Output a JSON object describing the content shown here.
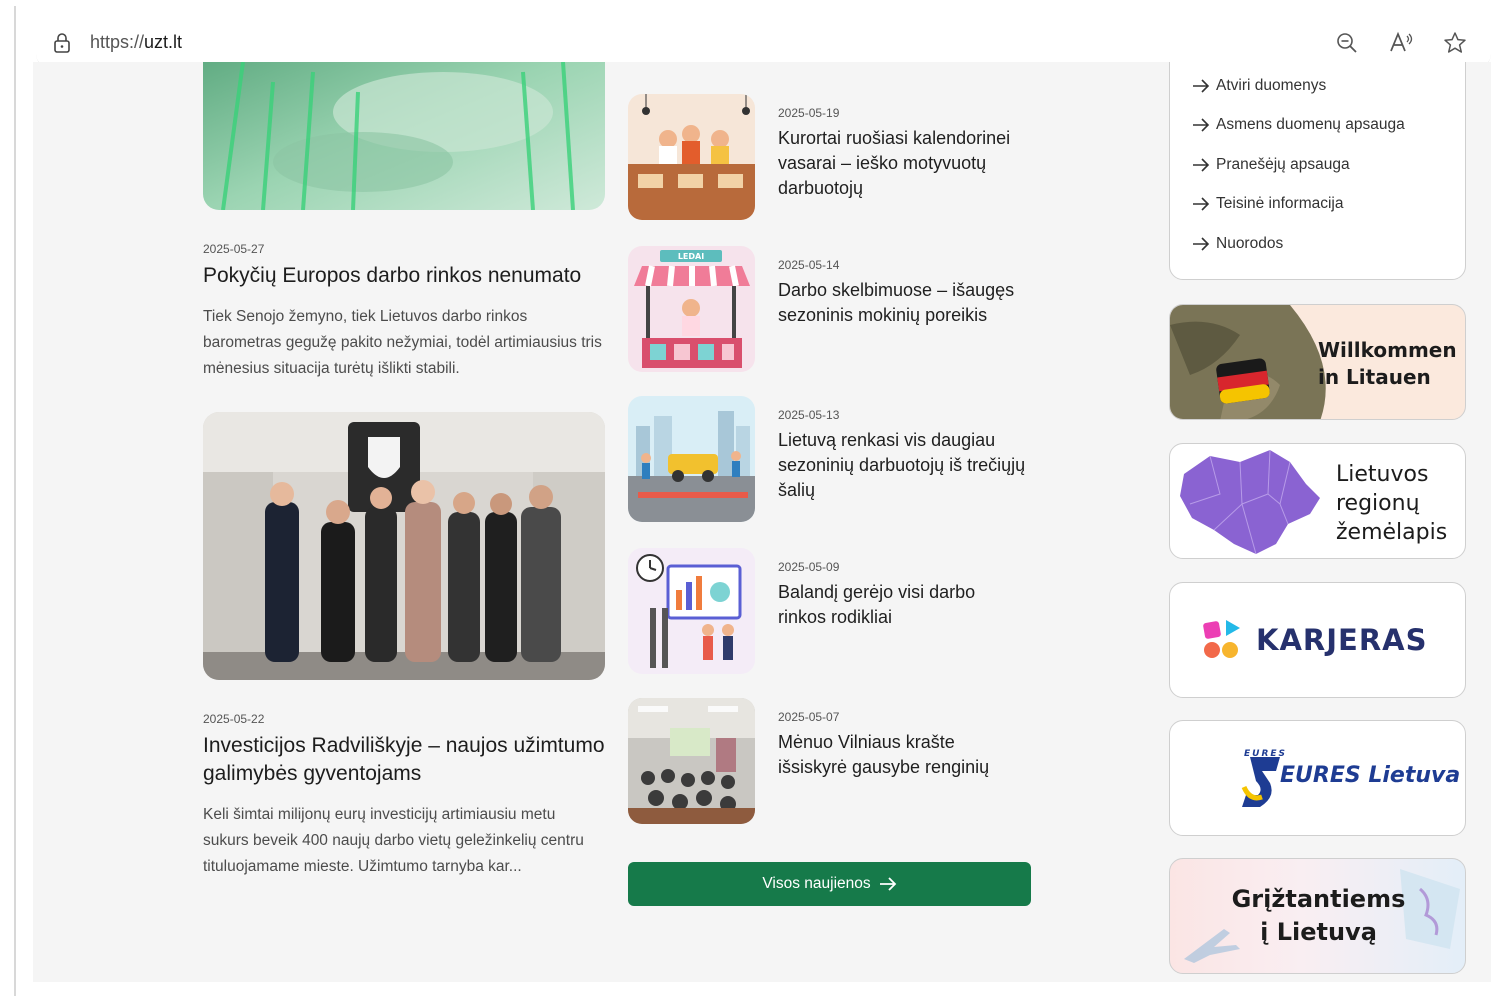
{
  "browser": {
    "url_protocol": "https://",
    "url_domain": "uzt.lt"
  },
  "left_articles": [
    {
      "date": "2025-05-27",
      "title": "Pokyčių Europos darbo rinkos nenumato",
      "excerpt": "Tiek Senojo žemyno, tiek Lietuvos darbo rinkos barometras gegužę pakito nežymiai, todėl artimiausius tris mėnesius situacija turėtų išlikti stabili."
    },
    {
      "date": "2025-05-22",
      "title": "Investicijos Radviliškyje – naujos užimtumo galimybės gyventojams",
      "excerpt": "Keli šimtai milijonų eurų investicijų artimiausiu metu sukurs beveik 400 naujų darbo vietų geležinkelių centru tituluojamame mieste. Užimtumo tarnyba kar..."
    }
  ],
  "news": [
    {
      "date": "2025-05-19",
      "title": "Kurortai ruošiasi kalendorinei vasarai – ieško motyvuotų darbuotojų"
    },
    {
      "date": "2025-05-14",
      "title": "Darbo skelbimuose – išaugęs sezoninis mokinių poreikis"
    },
    {
      "date": "2025-05-13",
      "title": "Lietuvą renkasi vis daugiau sezoninių darbuotojų iš trečiųjų šalių"
    },
    {
      "date": "2025-05-09",
      "title": "Balandį gerėjo visi darbo rinkos rodikliai"
    },
    {
      "date": "2025-05-07",
      "title": "Mėnuo Vilniaus krašte išsiskyrė gausybe renginių"
    }
  ],
  "all_news_label": "Visos naujienos",
  "thumb_badge": "LEDAI",
  "sidebar_links": [
    "Atviri duomenys",
    "Asmens duomenų apsauga",
    "Pranešėjų apsauga",
    "Teisinė informacija",
    "Nuorodos"
  ],
  "banners": {
    "willkommen": [
      "Willkommen",
      "in Litauen"
    ],
    "regionu": [
      "Lietuvos",
      "regionų",
      "žemėlapis"
    ],
    "karjeras": "KARJERAS",
    "eures_small": "EURES",
    "eures": "EURES Lietuva",
    "grizt": [
      "Grįžtantiems",
      "į Lietuvą"
    ]
  },
  "colors": {
    "accent_green": "#167a4a",
    "page_bg": "#f5f5f5"
  }
}
